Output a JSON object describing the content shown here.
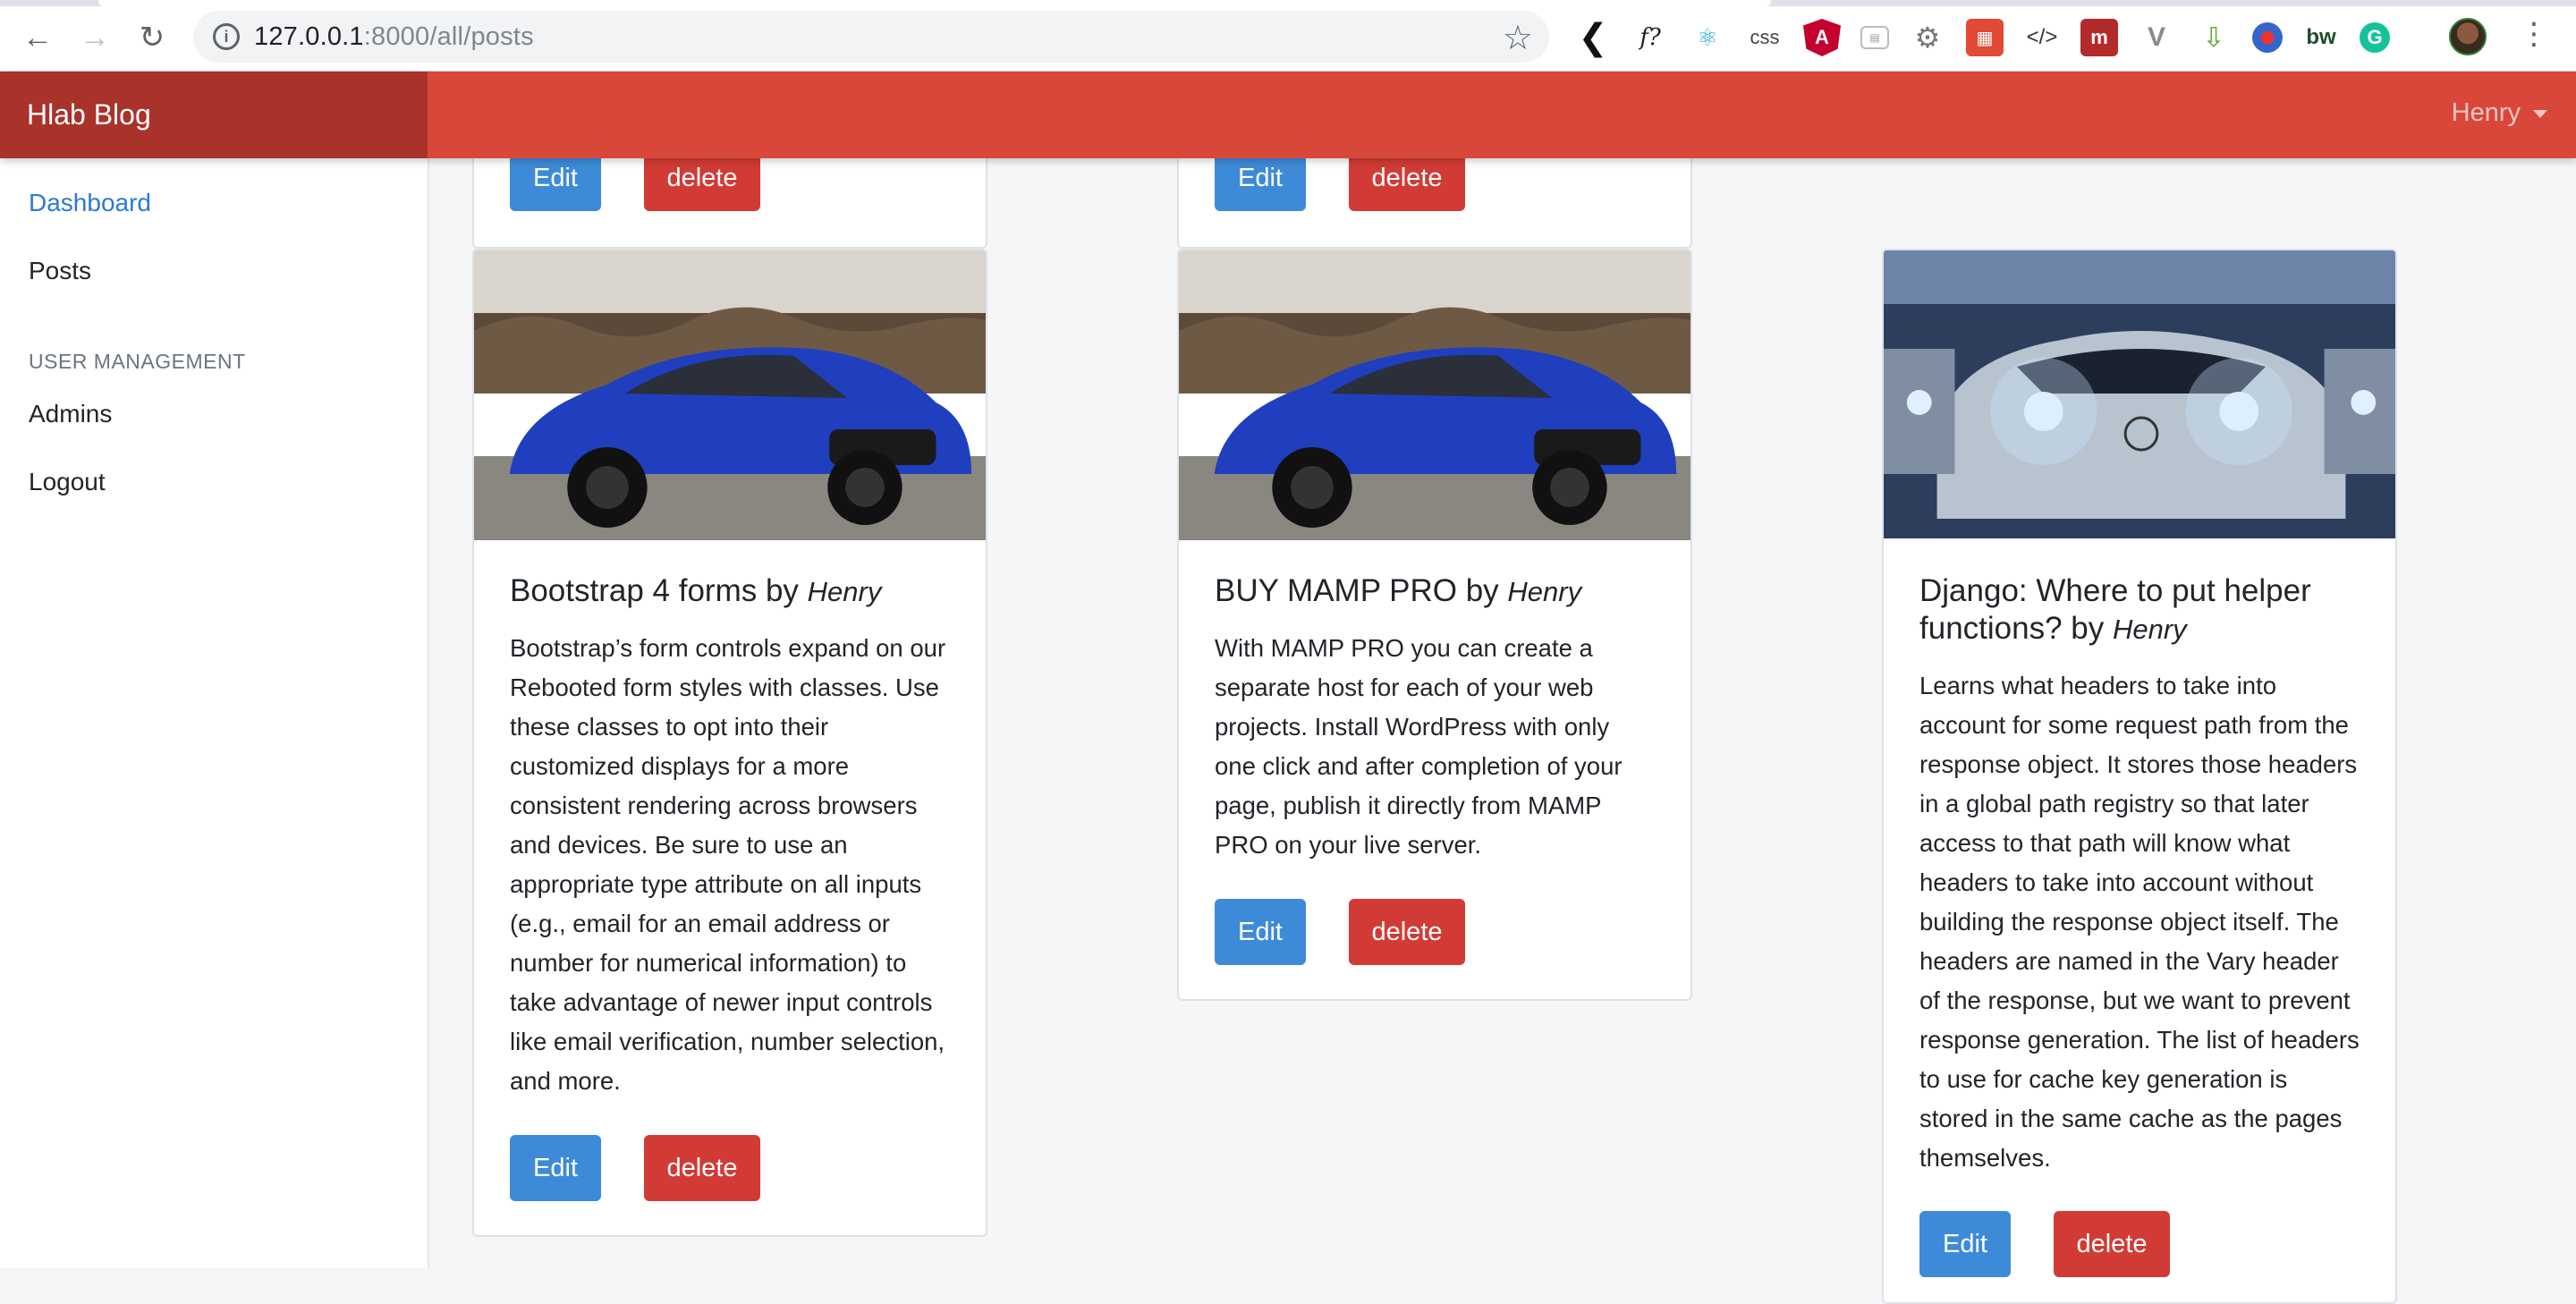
{
  "browser": {
    "url_host": "127.0.0.1",
    "url_rest": ":8000/all/posts",
    "extensions": [
      "back-chevron-icon",
      "f?",
      "react-icon",
      "css",
      "angular-icon",
      "ext-icon",
      "gear-icon",
      "ext-icon",
      "code-icon",
      "ext-icon",
      "ext-icon",
      "ext-icon",
      "ext-icon",
      "bw",
      "grammarly-icon"
    ],
    "ext_text": {
      "fquery": "f?",
      "css": "css",
      "bw": "bw",
      "g": "G"
    }
  },
  "header": {
    "brand": "Hlab Blog",
    "user": "Henry"
  },
  "sidebar": {
    "dashboard": "Dashboard",
    "posts": "Posts",
    "section": "USER MANAGEMENT",
    "admins": "Admins",
    "logout": "Logout"
  },
  "buttons": {
    "edit": "Edit",
    "delete": "delete"
  },
  "posts": [
    {
      "title": "Bootstrap 4 forms by",
      "author": "Henry",
      "body": "Bootstrap’s form controls expand on our Rebooted form styles with classes. Use these classes to opt into their customized displays for a more consistent rendering across browsers and devices. Be sure to use an appropriate type attribute on all inputs (e.g., email for an email address or number for numerical information) to take advantage of newer input controls like email verification, number selection, and more."
    },
    {
      "title": "BUY MAMP PRO by",
      "author": "Henry",
      "body": "With MAMP PRO you can create a separate host for each of your web projects. Install WordPress with only one click and after completion of your page, publish it directly from MAMP PRO on your live server."
    },
    {
      "title": "Django: Where to put helper functions? by",
      "author": "Henry",
      "body": "Learns what headers to take into account for some request path from the response object. It stores those headers in a global path registry so that later access to that path will know what headers to take into account without building the response object itself. The headers are named in the Vary header of the response, but we want to prevent response generation. The list of headers to use for cache key generation is stored in the same cache as the pages themselves."
    }
  ]
}
